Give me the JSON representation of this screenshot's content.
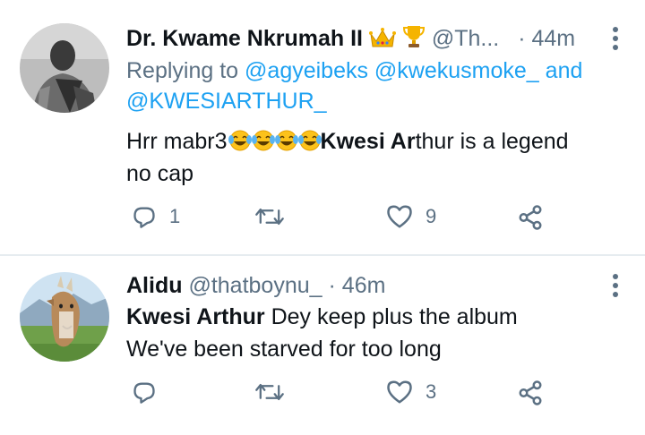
{
  "tweet1": {
    "display_name": "Dr. Kwame Nkrumah II",
    "badges": [
      "crown-emoji",
      "trophy-emoji"
    ],
    "handle": "@Th...",
    "separator": "·",
    "time": "44m",
    "replying_prefix": "Replying to ",
    "mentions_line1": "@agyeibeks @kwekusmoke_",
    "and_word": " and",
    "mention_line2": "@KWESIARTHUR_",
    "text_start": "Hrr mabr3",
    "emojis": [
      "face-with-tears-of-joy",
      "face-with-tears-of-joy",
      "face-with-tears-of-joy",
      "face-with-tears-of-joy"
    ],
    "text_bold": "Kwesi Ar",
    "text_rest": "thur is a legend",
    "text_line2": "no cap",
    "reply_count": "1",
    "retweet_count": "",
    "like_count": "9"
  },
  "tweet2": {
    "display_name": "Alidu",
    "handle": "@thatboynu_",
    "separator": "·",
    "time": "46m",
    "text_bold": "Kwesi Arthur",
    "text_rest": " Dey keep plus the album",
    "text_line2": "We've been starved for too long",
    "reply_count": "",
    "retweet_count": "",
    "like_count": "3"
  },
  "colors": {
    "accent": "#1da1f2",
    "muted": "#5b7083",
    "text": "#0f1419",
    "divider": "#e6ecf0"
  },
  "icons": [
    "reply-icon",
    "retweet-icon",
    "like-icon",
    "share-icon",
    "more-icon"
  ]
}
